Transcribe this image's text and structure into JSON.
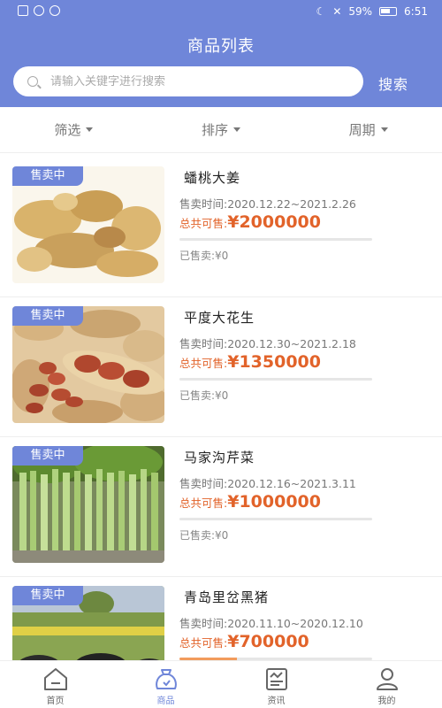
{
  "status_bar": {
    "battery": "59%",
    "time": "6:51"
  },
  "header": {
    "title": "商品列表"
  },
  "search": {
    "placeholder": "请输入关键字进行搜索",
    "button_label": "搜索"
  },
  "filters": [
    {
      "label": "筛选"
    },
    {
      "label": "排序"
    },
    {
      "label": "周期"
    }
  ],
  "products": [
    {
      "badge": "售卖中",
      "name": "蟠桃大姜",
      "period": "售卖时间:2020.12.22~2021.2.26",
      "total_label": "总共可售:",
      "total_amount": "¥2000000",
      "sold": "已售卖:¥0",
      "progress": 0
    },
    {
      "badge": "售卖中",
      "name": "平度大花生",
      "period": "售卖时间:2020.12.30~2021.2.18",
      "total_label": "总共可售:",
      "total_amount": "¥1350000",
      "sold": "已售卖:¥0",
      "progress": 0
    },
    {
      "badge": "售卖中",
      "name": "马家沟芹菜",
      "period": "售卖时间:2020.12.16~2021.3.11",
      "total_label": "总共可售:",
      "total_amount": "¥1000000",
      "sold": "已售卖:¥0",
      "progress": 0
    },
    {
      "badge": "售卖中",
      "name": "青岛里岔黑猪",
      "period": "售卖时间:2020.11.10~2020.12.10",
      "total_label": "总共可售:",
      "total_amount": "¥700000",
      "sold": "",
      "progress": 0.3
    }
  ],
  "tabbar": [
    {
      "label": "首页",
      "icon": "home-icon"
    },
    {
      "label": "商品",
      "icon": "bag-icon"
    },
    {
      "label": "资讯",
      "icon": "news-icon"
    },
    {
      "label": "我的",
      "icon": "user-icon"
    }
  ],
  "colors": {
    "primary": "#6f86d9",
    "price": "#e2632a",
    "progress": "#f29b5c"
  }
}
